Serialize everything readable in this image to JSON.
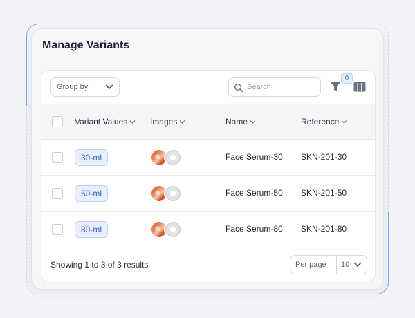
{
  "title": "Manage Variants",
  "toolbar": {
    "group_by_label": "Group by",
    "search_placeholder": "Search",
    "filter_count": "0"
  },
  "table": {
    "columns": [
      "Variant Values",
      "Images",
      "Name",
      "Reference"
    ],
    "rows": [
      {
        "variant": "30-ml",
        "name": "Face Serum-30",
        "reference": "SKN-201-30"
      },
      {
        "variant": "50-ml",
        "name": "Face Serum-50",
        "reference": "SKN-201-50"
      },
      {
        "variant": "80-ml",
        "name": "Face Serum-80",
        "reference": "SKN-201-80"
      }
    ]
  },
  "footer": {
    "summary": "Showing 1 to 3 of 3 results",
    "per_page_label": "Per page",
    "per_page_value": "10"
  },
  "icons": {
    "search": "search-icon",
    "filter": "filter-icon",
    "columns": "columns-icon",
    "chevron": "chevron-down-icon",
    "sort": "sort-chevron-icon"
  },
  "colors": {
    "accent": "#3b67c4",
    "chip_bg": "#e8f0fd",
    "background": "#f3f4f8"
  }
}
